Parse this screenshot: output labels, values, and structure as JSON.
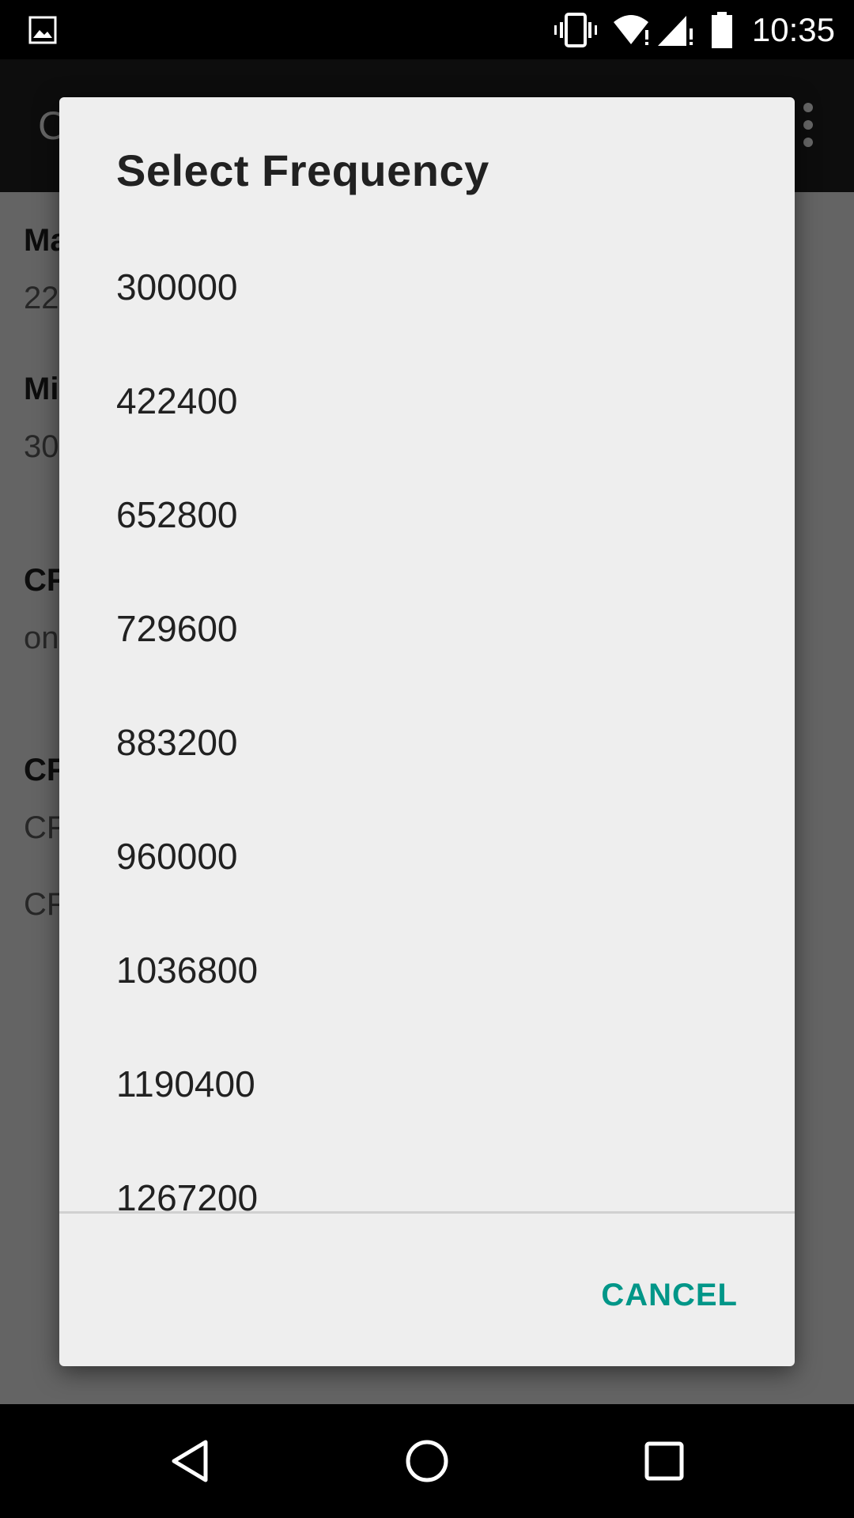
{
  "status_bar": {
    "time": "10:35",
    "icons": [
      "image-notification-icon",
      "vibrate-icon",
      "wifi-icon",
      "cell-signal-icon",
      "battery-icon"
    ]
  },
  "app": {
    "title": "C",
    "prefs": [
      {
        "title": "Ma",
        "value": "22"
      },
      {
        "title": "Mi",
        "value": "30"
      },
      {
        "title": "CF",
        "value": "on"
      },
      {
        "title": "CF",
        "value": "CF",
        "value2": "CF"
      }
    ]
  },
  "dialog": {
    "title": "Select Frequency",
    "options": [
      "300000",
      "422400",
      "652800",
      "729600",
      "883200",
      "960000",
      "1036800",
      "1190400",
      "1267200"
    ],
    "cancel_label": "CANCEL"
  },
  "nav_bar": {
    "icons": [
      "back-icon",
      "home-icon",
      "recents-icon"
    ]
  },
  "colors": {
    "accent": "#009688",
    "dialog_bg": "#eeeeee",
    "app_bar": "#212121"
  }
}
